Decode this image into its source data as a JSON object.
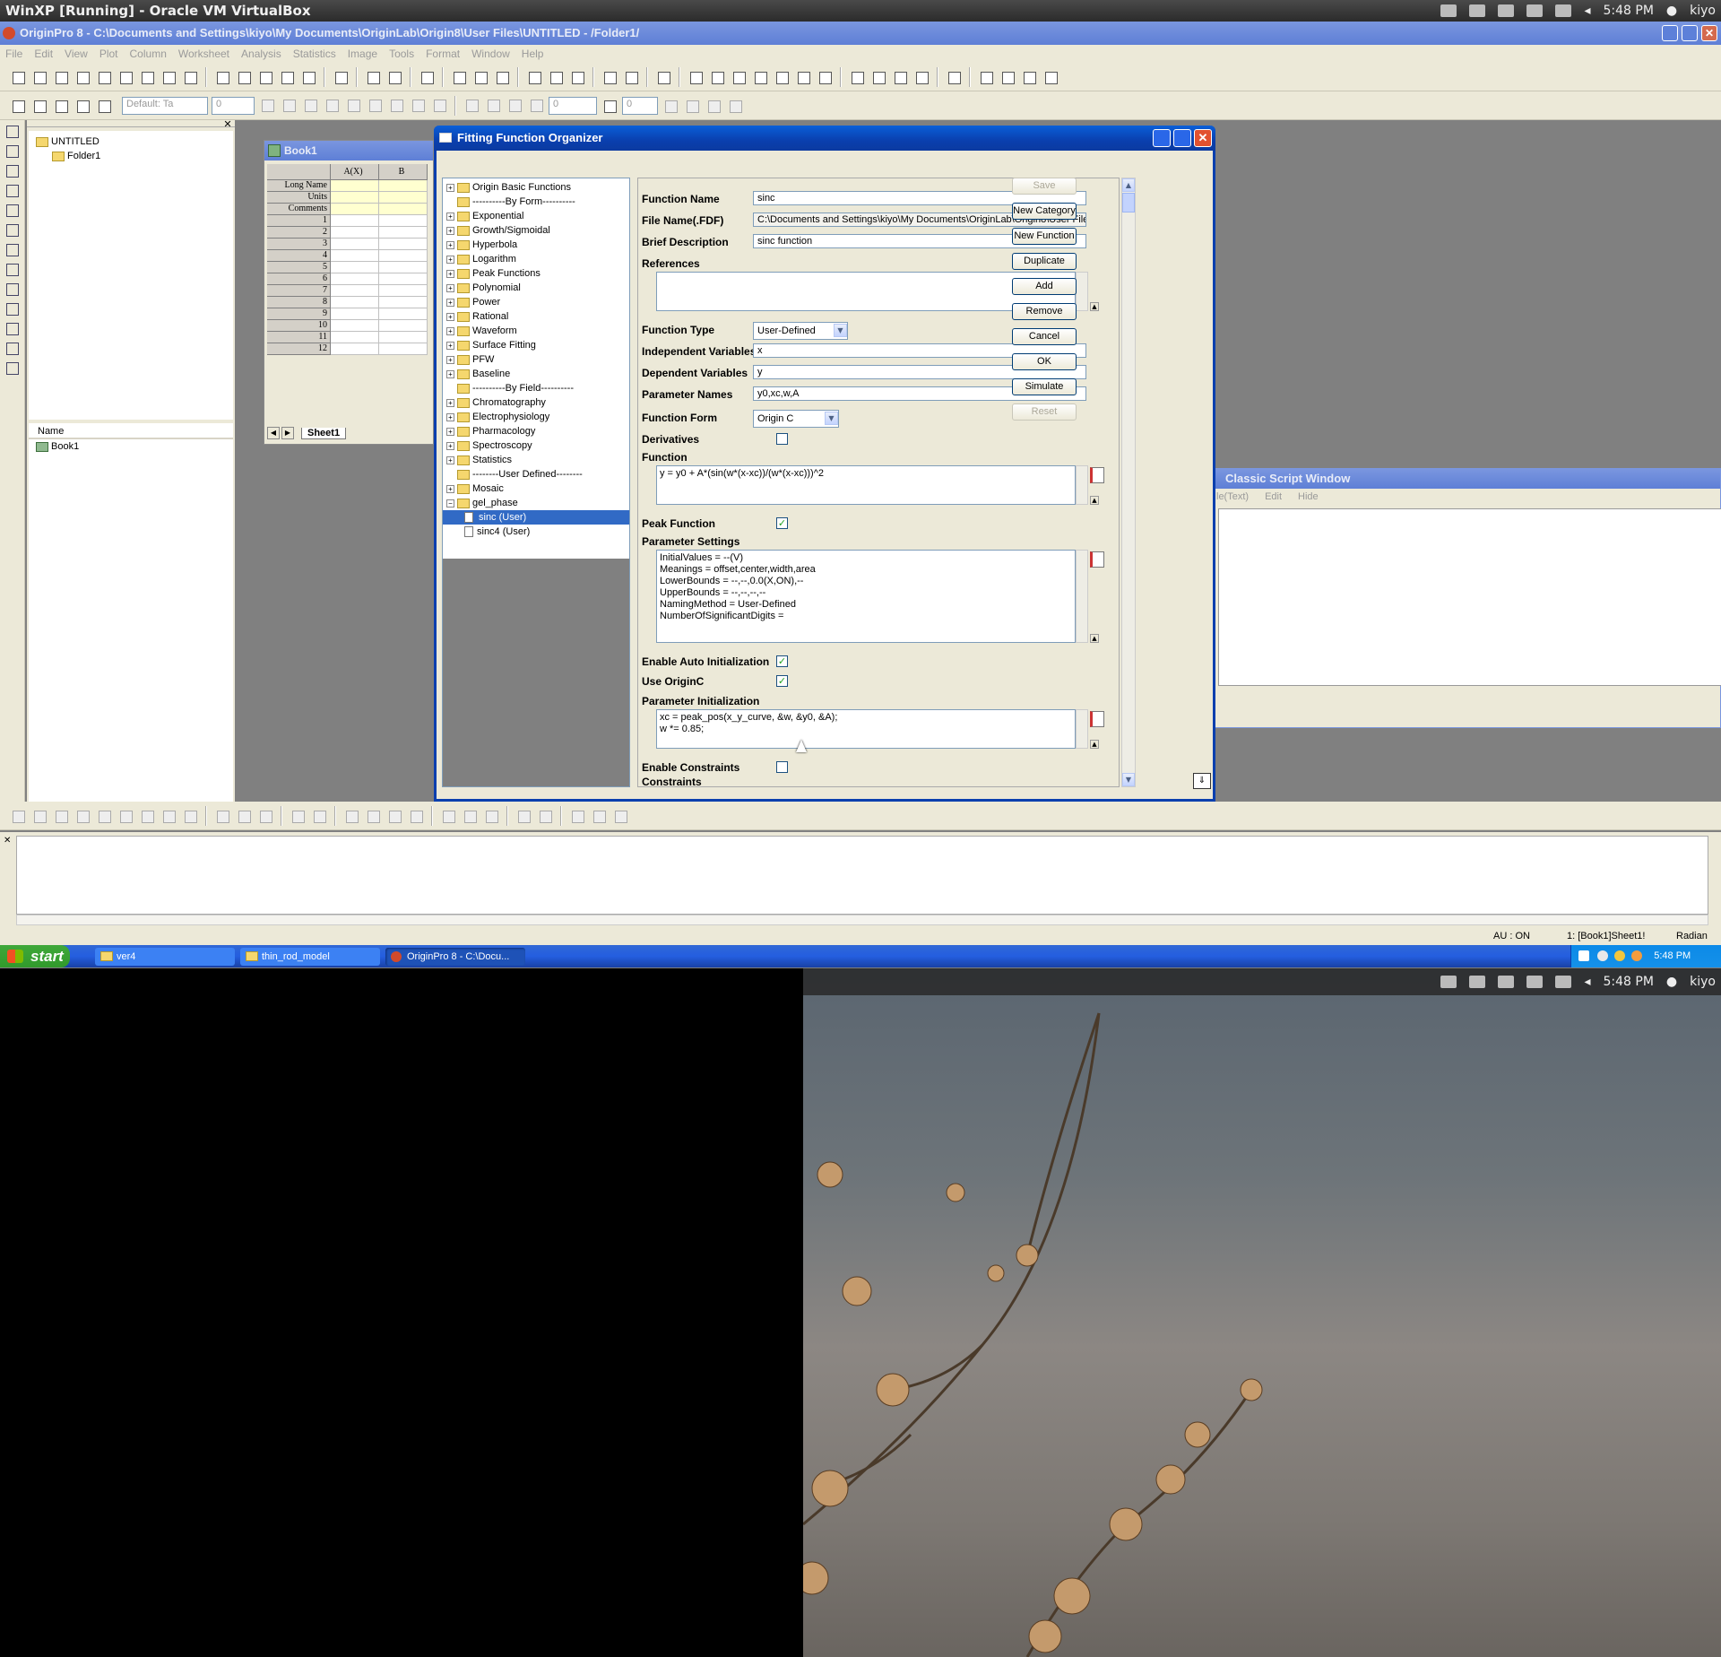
{
  "host": {
    "title": "WinXP [Running] - Oracle VM VirtualBox",
    "time": "5:48 PM",
    "user": "kiyo"
  },
  "origin": {
    "title": "OriginPro 8 - C:\\Documents and Settings\\kiyo\\My Documents\\OriginLab\\Origin8\\User Files\\UNTITLED - /Folder1/",
    "menu": [
      "File",
      "Edit",
      "View",
      "Plot",
      "Column",
      "Worksheet",
      "Analysis",
      "Statistics",
      "Image",
      "Tools",
      "Format",
      "Window",
      "Help"
    ],
    "font_box": "Default: Ta",
    "font_size": "0",
    "line_width": "0",
    "line_width2": "0"
  },
  "project_explorer": {
    "root": "UNTITLED",
    "folder": "Folder1",
    "name_header": "Name",
    "item": "Book1"
  },
  "book": {
    "title": "Book1",
    "col_a": "A(X)",
    "col_b": "B",
    "row_labels": [
      "Long Name",
      "Units",
      "Comments",
      "1",
      "2",
      "3",
      "4",
      "5",
      "6",
      "7",
      "8",
      "9",
      "10",
      "11",
      "12"
    ],
    "sheet_tab": "Sheet1"
  },
  "dialog": {
    "title": "Fitting Function Organizer",
    "tree": [
      {
        "label": "Origin Basic Functions",
        "type": "folder",
        "plus": true
      },
      {
        "label": "----------By Form----------",
        "type": "folder",
        "plus": false
      },
      {
        "label": "Exponential",
        "type": "folder",
        "plus": true
      },
      {
        "label": "Growth/Sigmoidal",
        "type": "folder",
        "plus": true
      },
      {
        "label": "Hyperbola",
        "type": "folder",
        "plus": true
      },
      {
        "label": "Logarithm",
        "type": "folder",
        "plus": true
      },
      {
        "label": "Peak Functions",
        "type": "folder",
        "plus": true
      },
      {
        "label": "Polynomial",
        "type": "folder",
        "plus": true
      },
      {
        "label": "Power",
        "type": "folder",
        "plus": true
      },
      {
        "label": "Rational",
        "type": "folder",
        "plus": true
      },
      {
        "label": "Waveform",
        "type": "folder",
        "plus": true
      },
      {
        "label": "Surface Fitting",
        "type": "folder",
        "plus": true
      },
      {
        "label": "PFW",
        "type": "folder",
        "plus": true
      },
      {
        "label": "Baseline",
        "type": "folder",
        "plus": true
      },
      {
        "label": "----------By Field----------",
        "type": "folder",
        "plus": false
      },
      {
        "label": "Chromatography",
        "type": "folder",
        "plus": true
      },
      {
        "label": "Electrophysiology",
        "type": "folder",
        "plus": true
      },
      {
        "label": "Pharmacology",
        "type": "folder",
        "plus": true
      },
      {
        "label": "Spectroscopy",
        "type": "folder",
        "plus": true
      },
      {
        "label": "Statistics",
        "type": "folder",
        "plus": true
      },
      {
        "label": "--------User Defined--------",
        "type": "folder",
        "plus": false
      },
      {
        "label": "Mosaic",
        "type": "folder",
        "plus": true
      },
      {
        "label": "gel_phase",
        "type": "folder",
        "plus": true,
        "open": true
      },
      {
        "label": "sinc (User)",
        "type": "doc",
        "selected": true
      },
      {
        "label": "sinc4 (User)",
        "type": "doc"
      }
    ],
    "labels": {
      "function_name": "Function Name",
      "file_name": "File Name(.FDF)",
      "brief": "Brief Description",
      "references": "References",
      "function_type": "Function Type",
      "indep": "Independent Variables",
      "dep": "Dependent Variables",
      "params": "Parameter Names",
      "function_form": "Function Form",
      "derivatives": "Derivatives",
      "function": "Function",
      "peak": "Peak Function",
      "param_settings": "Parameter Settings",
      "auto_init": "Enable Auto Initialization",
      "use_originc": "Use OriginC",
      "param_init": "Parameter Initialization",
      "enable_constraints": "Enable Constraints",
      "constraints": "Constraints"
    },
    "values": {
      "function_name": "sinc",
      "file_name": "C:\\Documents and Settings\\kiyo\\My Documents\\OriginLab\\Origin8\\User File",
      "brief": "sinc function",
      "references": "",
      "function_type": "User-Defined",
      "indep": "x",
      "dep": "y",
      "params": "y0,xc,w,A",
      "function_form": "Origin C",
      "function": "y = y0 + A*(sin(w*(x-xc))/(w*(x-xc)))^2",
      "param_settings": "InitialValues = --(V)\nMeanings = offset,center,width,area\nLowerBounds = --,--,0.0(X,ON),--\nUpperBounds = --,--,--,--\nNamingMethod = User-Defined\nNumberOfSignificantDigits =",
      "param_init": "xc = peak_pos(x_y_curve, &w, &y0, &A);\nw *= 0.85;"
    },
    "checks": {
      "derivatives": false,
      "peak": true,
      "auto_init": true,
      "use_originc": true,
      "enable_constraints": false
    },
    "buttons": [
      "Save",
      "New Category",
      "New Function",
      "Duplicate",
      "Add",
      "Remove",
      "Cancel",
      "OK",
      "Simulate",
      "Reset"
    ]
  },
  "script_window": {
    "title": "Classic Script Window",
    "menu": [
      "le(Text)",
      "Edit",
      "Hide"
    ]
  },
  "status": {
    "au": "AU : ON",
    "sheet": "1: [Book1]Sheet1!",
    "angle": "Radian"
  },
  "taskbar": {
    "start": "start",
    "items": [
      "ver4",
      "thin_rod_model",
      "OriginPro 8 - C:\\Docu..."
    ],
    "time": "5:48 PM"
  },
  "host2": {
    "time": "5:48 PM",
    "user": "kiyo"
  }
}
